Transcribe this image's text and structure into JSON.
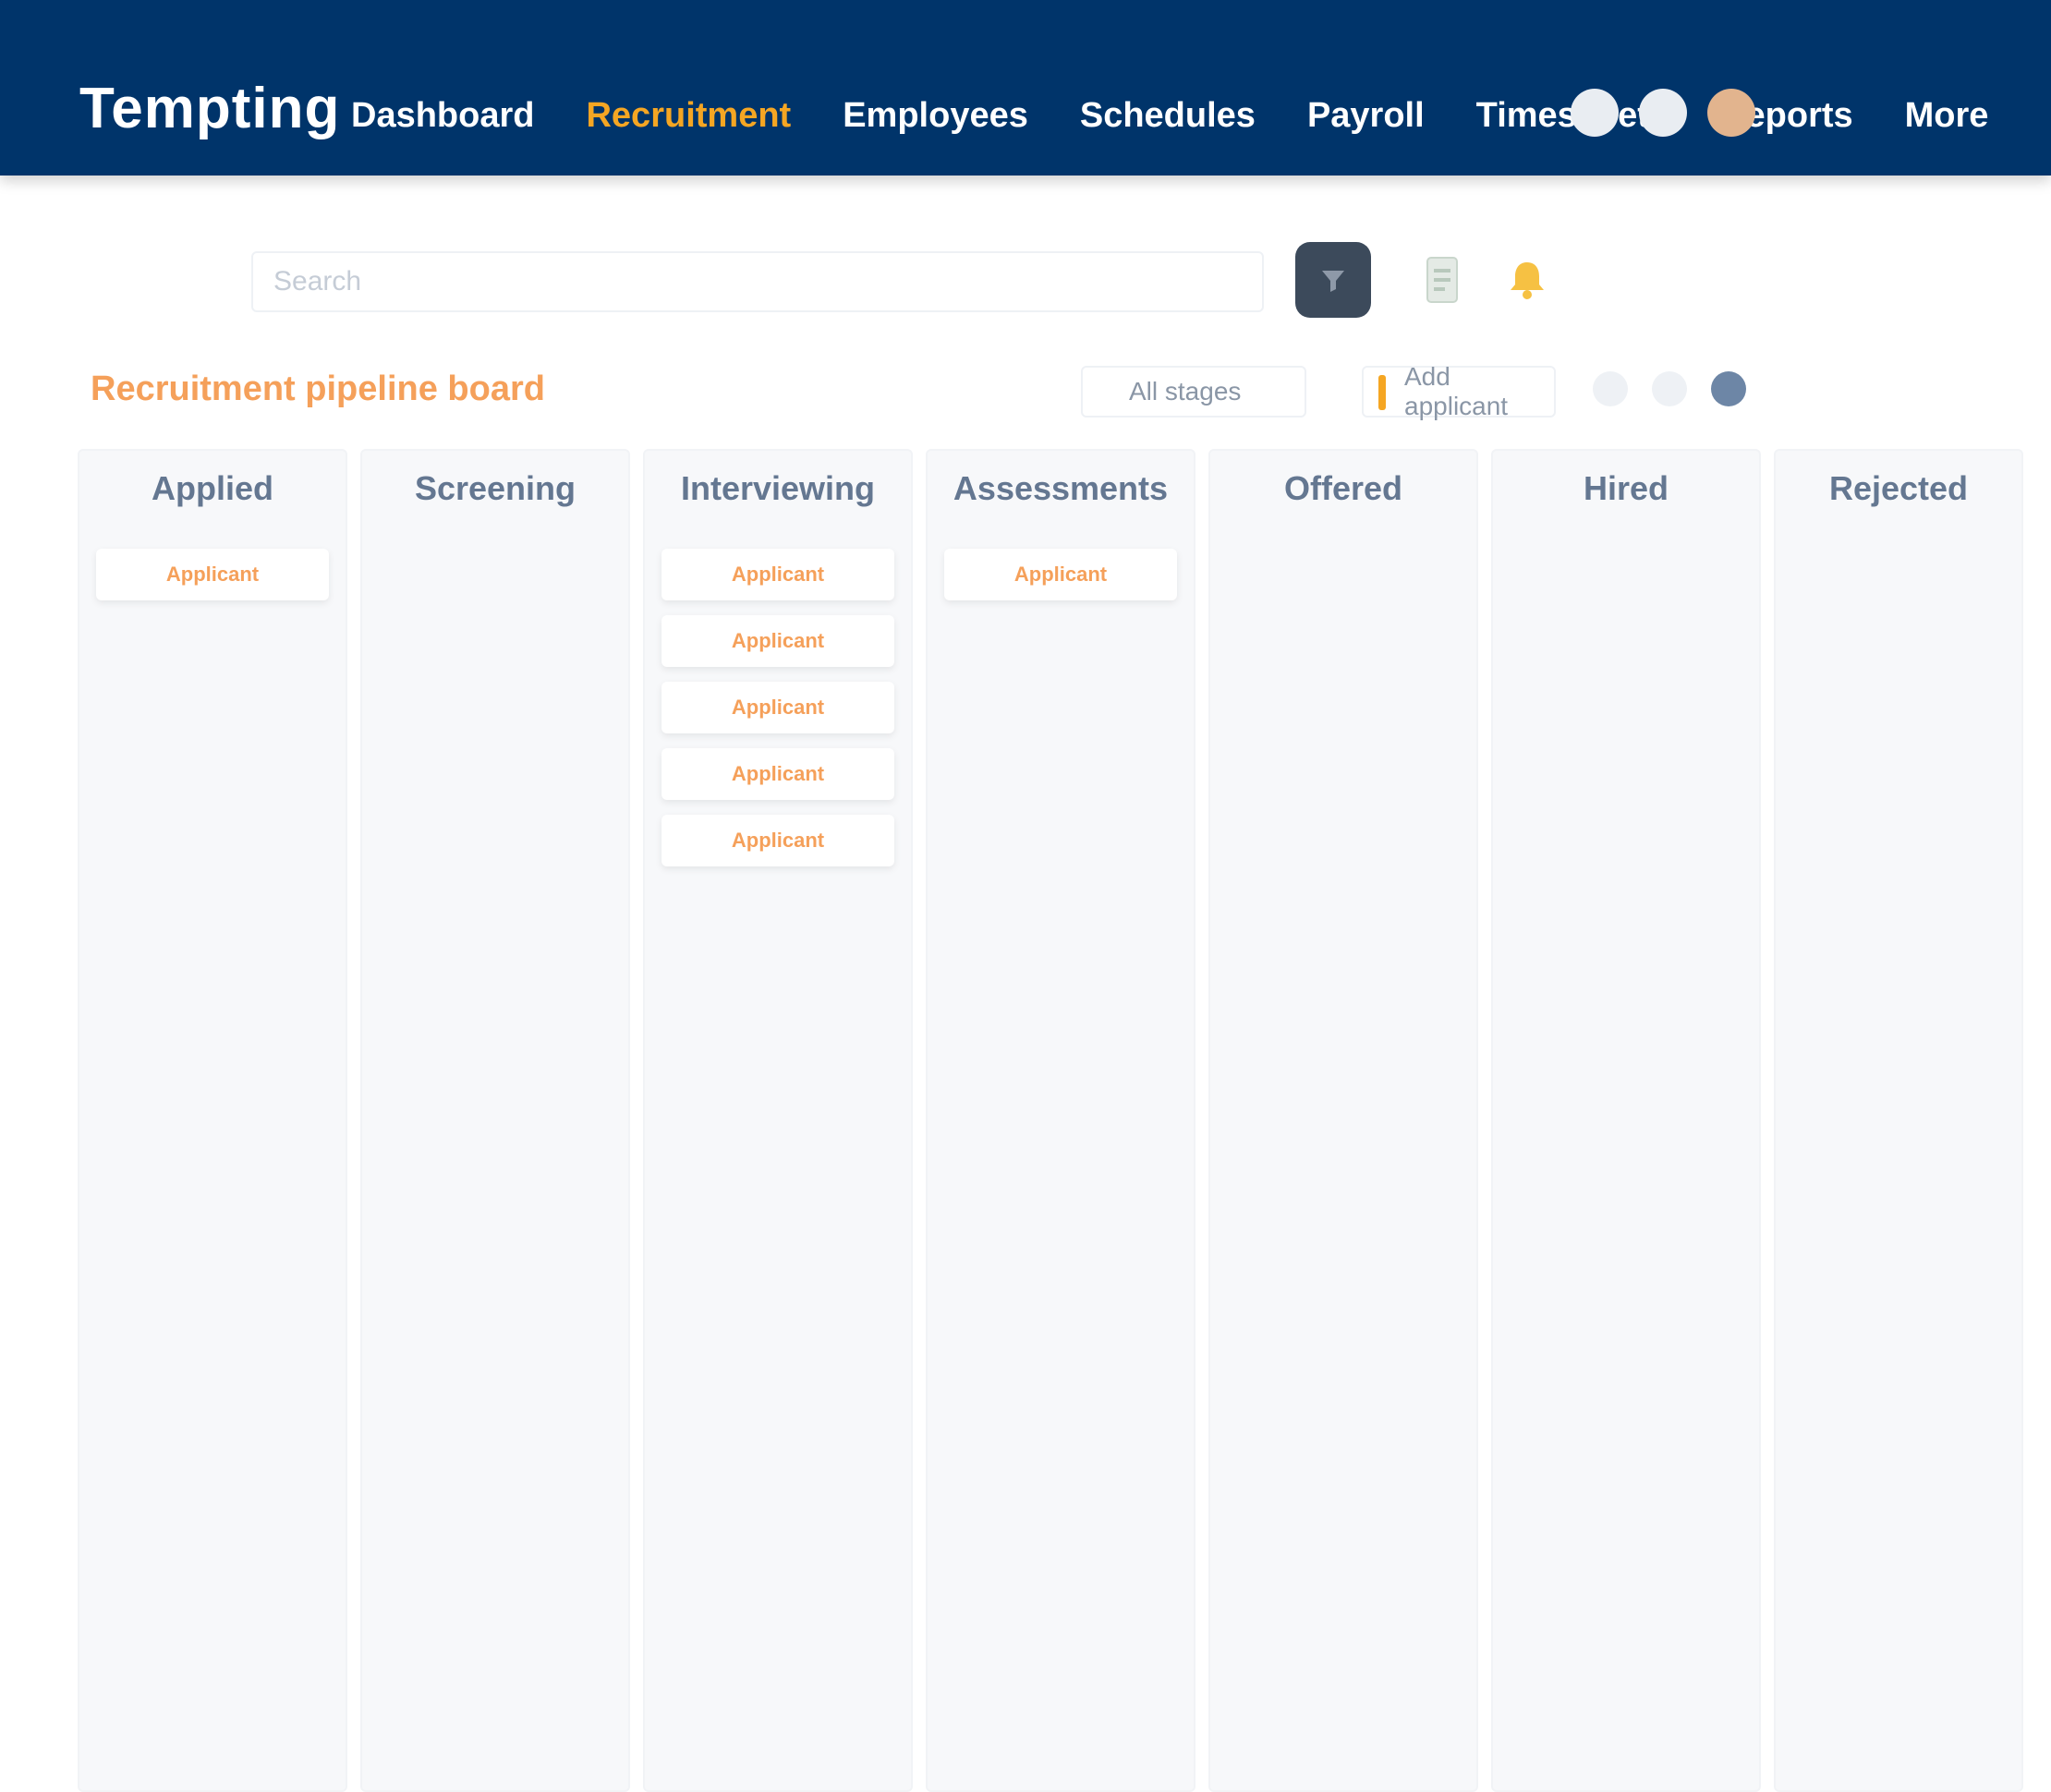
{
  "app": {
    "logo": "Tempting",
    "nav": [
      {
        "label": "Dashboard",
        "active": false
      },
      {
        "label": "Recruitment",
        "active": true
      },
      {
        "label": "Employees",
        "active": false
      },
      {
        "label": "Schedules",
        "active": false
      },
      {
        "label": "Payroll",
        "active": false
      },
      {
        "label": "Timesheets",
        "active": false
      },
      {
        "label": "Reports",
        "active": false
      },
      {
        "label": "More",
        "active": false
      }
    ]
  },
  "toolbar": {
    "search_placeholder": "Search",
    "filter_label": "All stages",
    "add_label": "Add applicant",
    "accent": "#f5a623"
  },
  "board": {
    "title": "Recruitment pipeline board",
    "columns": [
      {
        "name": "Applied",
        "cards": [
          "Applicant"
        ]
      },
      {
        "name": "Screening",
        "cards": []
      },
      {
        "name": "Interviewing",
        "cards": [
          "Applicant",
          "Applicant",
          "Applicant",
          "Applicant",
          "Applicant"
        ]
      },
      {
        "name": "Assessments",
        "cards": [
          "Applicant"
        ]
      },
      {
        "name": "Offered",
        "cards": []
      },
      {
        "name": "Hired",
        "cards": []
      },
      {
        "name": "Rejected",
        "cards": []
      }
    ]
  }
}
